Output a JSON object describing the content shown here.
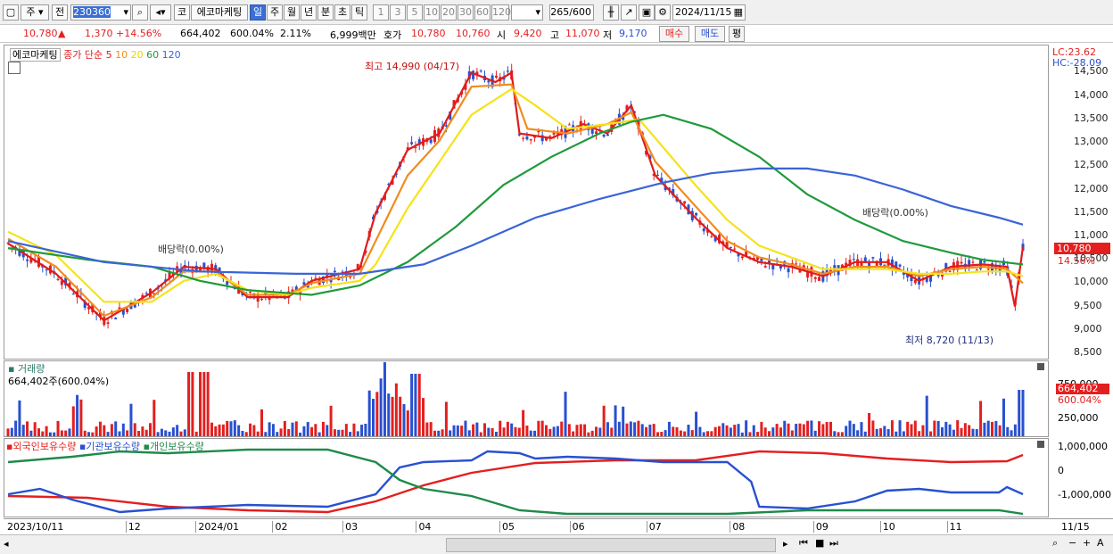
{
  "toolbar": {
    "type_label": "주",
    "prev_label": "전",
    "code": "230360",
    "kospi_label": "코",
    "stock_name": "에코마케팅",
    "periods": [
      "일",
      "주",
      "월",
      "년",
      "분",
      "초",
      "틱"
    ],
    "active_period": "일",
    "ranges": [
      "1",
      "3",
      "5",
      "10",
      "20",
      "30",
      "60",
      "120"
    ],
    "count": "265",
    "count_total": "/600",
    "date": "2024/11/15"
  },
  "info": {
    "price": "10,780",
    "change": "1,370",
    "change_pct": "+14.56%",
    "volume": "664,402",
    "volume_pct": "600.04%",
    "turnover": "2.11%",
    "amount": "6,999백만",
    "ask_label": "호가",
    "ask1": "10,780",
    "ask2": "10,760",
    "open_label": "시",
    "open": "9,420",
    "high_label": "고",
    "high": "11,070",
    "low_label": "저",
    "low": "9,170",
    "buy_label": "매수",
    "sell_label": "매도",
    "avg_label": "평"
  },
  "colors": {
    "up": "#e41f1f",
    "down": "#2850d0",
    "ma5": "#e01b1b",
    "ma10": "#f08c1e",
    "ma20": "#f5e31a",
    "ma60": "#1f9a3a",
    "ma120": "#3a64d8"
  },
  "price_panel": {
    "legend_name": "에코마케팅",
    "legend_ma": "종가 단순",
    "ma_periods": [
      "5",
      "10",
      "20",
      "60",
      "120"
    ],
    "lc": "LC:23.62",
    "hc": "HC:-28.09",
    "high_note": "최고 14,990 (04/17)",
    "low_note": "최저 8,720 (11/13)",
    "dividend_note": "배당락(0.00%)",
    "price_tag": "10,780",
    "pct_tag": "14.56%",
    "y_labels": [
      "14,500",
      "14,000",
      "13,500",
      "13,000",
      "12,500",
      "12,000",
      "11,500",
      "11,000",
      "10,500",
      "10,000",
      "9,500",
      "9,000",
      "8,500"
    ]
  },
  "volume_panel": {
    "title": "거래량",
    "value_note": "664,402주(600.04%)",
    "y_labels": [
      "750,000",
      "500,000",
      "250,000"
    ],
    "vol_tag": "664,402",
    "pct_tag": "600.04%"
  },
  "holding_panel": {
    "legends": [
      "외국인보유수량",
      "기관보유수량",
      "개인보유수량"
    ],
    "y_labels": [
      "1,000,000",
      "0",
      "-1,000,000"
    ]
  },
  "x_labels": [
    "2023/10/11",
    "12",
    "2024/01",
    "02",
    "03",
    "04",
    "05",
    "06",
    "07",
    "08",
    "09",
    "10",
    "11",
    "11/15"
  ],
  "chart_data": {
    "type": "line",
    "title": "",
    "x_range": [
      "2023/10/11",
      "2024/11/15"
    ],
    "ylim": [
      8500,
      14700
    ],
    "series": [
      {
        "name": "5",
        "values": [
          [
            0,
            10850
          ],
          [
            6,
            10200
          ],
          [
            12,
            9200
          ],
          [
            18,
            9800
          ],
          [
            22,
            10350
          ],
          [
            26,
            10300
          ],
          [
            30,
            9700
          ],
          [
            35,
            9700
          ],
          [
            38,
            10050
          ],
          [
            44,
            10300
          ],
          [
            46,
            11500
          ],
          [
            50,
            12850
          ],
          [
            54,
            13200
          ],
          [
            58,
            14500
          ],
          [
            61,
            14300
          ],
          [
            63,
            14500
          ],
          [
            64,
            13200
          ],
          [
            68,
            13100
          ],
          [
            72,
            13400
          ],
          [
            75,
            13200
          ],
          [
            78,
            13800
          ],
          [
            81,
            12300
          ],
          [
            86,
            11400
          ],
          [
            90,
            10750
          ],
          [
            94,
            10450
          ],
          [
            98,
            10350
          ],
          [
            102,
            10150
          ],
          [
            106,
            10450
          ],
          [
            110,
            10450
          ],
          [
            114,
            10050
          ],
          [
            118,
            10350
          ],
          [
            122,
            10400
          ],
          [
            125,
            10350
          ],
          [
            126,
            9500
          ],
          [
            127,
            10780
          ]
        ]
      },
      {
        "name": "10",
        "values": [
          [
            0,
            10950
          ],
          [
            6,
            10350
          ],
          [
            12,
            9300
          ],
          [
            18,
            9700
          ],
          [
            22,
            10250
          ],
          [
            26,
            10250
          ],
          [
            30,
            9750
          ],
          [
            35,
            9750
          ],
          [
            38,
            10000
          ],
          [
            44,
            10200
          ],
          [
            46,
            10900
          ],
          [
            50,
            12300
          ],
          [
            54,
            13050
          ],
          [
            58,
            14200
          ],
          [
            63,
            14250
          ],
          [
            65,
            13300
          ],
          [
            70,
            13200
          ],
          [
            75,
            13400
          ],
          [
            78,
            13650
          ],
          [
            81,
            12600
          ],
          [
            86,
            11650
          ],
          [
            90,
            10900
          ],
          [
            94,
            10550
          ],
          [
            98,
            10400
          ],
          [
            102,
            10200
          ],
          [
            106,
            10350
          ],
          [
            110,
            10350
          ],
          [
            114,
            10150
          ],
          [
            118,
            10300
          ],
          [
            122,
            10350
          ],
          [
            125,
            10300
          ],
          [
            127,
            10000
          ]
        ]
      },
      {
        "name": "20",
        "values": [
          [
            0,
            11100
          ],
          [
            6,
            10600
          ],
          [
            12,
            9600
          ],
          [
            18,
            9600
          ],
          [
            22,
            10050
          ],
          [
            26,
            10200
          ],
          [
            30,
            9850
          ],
          [
            35,
            9750
          ],
          [
            38,
            9900
          ],
          [
            44,
            10050
          ],
          [
            46,
            10400
          ],
          [
            50,
            11600
          ],
          [
            54,
            12600
          ],
          [
            58,
            13600
          ],
          [
            63,
            14150
          ],
          [
            66,
            13800
          ],
          [
            70,
            13300
          ],
          [
            75,
            13400
          ],
          [
            79,
            13500
          ],
          [
            82,
            12900
          ],
          [
            86,
            12100
          ],
          [
            90,
            11350
          ],
          [
            94,
            10800
          ],
          [
            98,
            10550
          ],
          [
            102,
            10300
          ],
          [
            106,
            10300
          ],
          [
            110,
            10300
          ],
          [
            114,
            10200
          ],
          [
            118,
            10200
          ],
          [
            122,
            10250
          ],
          [
            125,
            10250
          ],
          [
            127,
            10150
          ]
        ]
      },
      {
        "name": "60",
        "values": [
          [
            0,
            10750
          ],
          [
            10,
            10500
          ],
          [
            18,
            10350
          ],
          [
            24,
            10050
          ],
          [
            30,
            9850
          ],
          [
            38,
            9750
          ],
          [
            44,
            9950
          ],
          [
            50,
            10450
          ],
          [
            56,
            11200
          ],
          [
            62,
            12100
          ],
          [
            68,
            12700
          ],
          [
            74,
            13200
          ],
          [
            78,
            13450
          ],
          [
            82,
            13600
          ],
          [
            88,
            13300
          ],
          [
            94,
            12700
          ],
          [
            100,
            11900
          ],
          [
            106,
            11350
          ],
          [
            112,
            10900
          ],
          [
            118,
            10650
          ],
          [
            122,
            10500
          ],
          [
            127,
            10400
          ]
        ]
      },
      {
        "name": "120",
        "values": [
          [
            0,
            10900
          ],
          [
            12,
            10450
          ],
          [
            24,
            10250
          ],
          [
            36,
            10200
          ],
          [
            44,
            10200
          ],
          [
            52,
            10400
          ],
          [
            58,
            10800
          ],
          [
            66,
            11400
          ],
          [
            74,
            11800
          ],
          [
            82,
            12150
          ],
          [
            88,
            12350
          ],
          [
            94,
            12450
          ],
          [
            100,
            12450
          ],
          [
            106,
            12300
          ],
          [
            112,
            12000
          ],
          [
            118,
            11650
          ],
          [
            124,
            11400
          ],
          [
            127,
            11250
          ]
        ]
      }
    ]
  }
}
